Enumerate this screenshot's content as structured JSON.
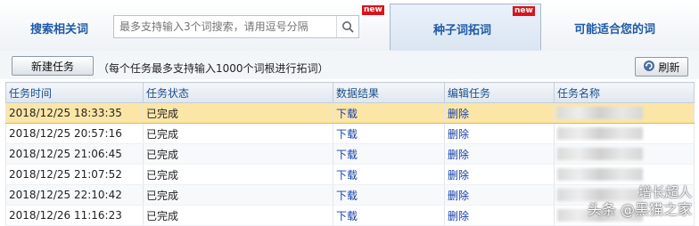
{
  "tabs": {
    "search": {
      "label": "搜索相关词",
      "placeholder": "最多支持输入3个词搜索，请用逗号分隔"
    },
    "seed": {
      "label": "种子词拓词",
      "badge": "new"
    },
    "suggest": {
      "label": "可能适合您的词"
    },
    "search_badge": "new"
  },
  "toolbar": {
    "new_task": "新建任务",
    "hint": "（每个任务最多支持输入1000个词根进行拓词）",
    "refresh": "刷新"
  },
  "table": {
    "headers": [
      "任务时间",
      "任务状态",
      "数据结果",
      "编辑任务",
      "任务名称"
    ],
    "rows": [
      {
        "time": "2018/12/25 18:33:35",
        "status": "已完成",
        "result": "下载",
        "edit": "删除"
      },
      {
        "time": "2018/12/25 20:57:16",
        "status": "已完成",
        "result": "下载",
        "edit": "删除"
      },
      {
        "time": "2018/12/25 21:06:45",
        "status": "已完成",
        "result": "下载",
        "edit": "删除"
      },
      {
        "time": "2018/12/25 21:07:52",
        "status": "已完成",
        "result": "下载",
        "edit": "删除"
      },
      {
        "time": "2018/12/25 22:10:42",
        "status": "已完成",
        "result": "下载",
        "edit": "删除"
      },
      {
        "time": "2018/12/26 11:16:23",
        "status": "已完成",
        "result": "下载",
        "edit": "删除"
      }
    ]
  },
  "watermark": {
    "line1": "增长超人",
    "line2": "头条 @黑猫之家"
  },
  "colors": {
    "accent": "#1f5aa6",
    "selected_row": "#fbe6a8",
    "badge": "#d8131b",
    "link": "#1740a8"
  }
}
